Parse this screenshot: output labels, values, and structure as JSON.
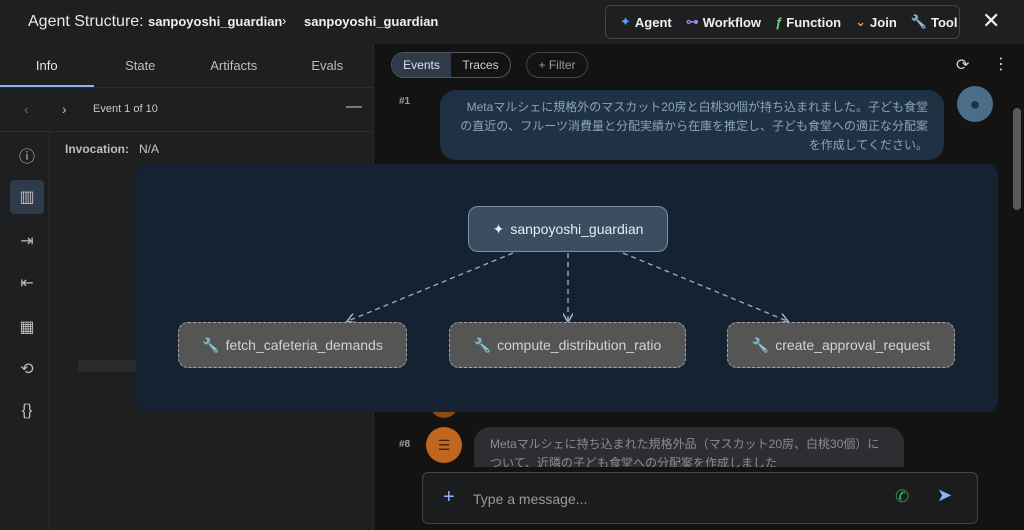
{
  "header": {
    "title": "Agent Structure:",
    "breadcrumb": [
      "sanpoyoshi_guardian",
      "sanpoyoshi_guardian"
    ],
    "legend": [
      {
        "icon": "sparkle-icon",
        "glyph": "✦",
        "color": "#4da3ff",
        "label": "Agent"
      },
      {
        "icon": "workflow-icon",
        "glyph": "⊶",
        "color": "#b07cf0",
        "label": "Workflow"
      },
      {
        "icon": "function-icon",
        "glyph": "ƒ",
        "color": "#6fd47a",
        "label": "Function"
      },
      {
        "icon": "join-icon",
        "glyph": "⌄",
        "color": "#f2a23c",
        "label": "Join"
      },
      {
        "icon": "wrench-icon",
        "glyph": "🔧",
        "color": "#e0e0e0",
        "label": "Tool"
      }
    ]
  },
  "left": {
    "tabs": [
      "Info",
      "State",
      "Artifacts",
      "Evals"
    ],
    "active_tab": "Info",
    "event_nav": "Event 1 of 10",
    "invocation_label": "Invocation:",
    "invocation_value": "N/A"
  },
  "right": {
    "view_tabs": [
      "Events",
      "Traces"
    ],
    "active_view": "Events",
    "filter_label": "Filter",
    "events": [
      {
        "num": "#1",
        "role": "user",
        "text": "Metaマルシェに規格外のマスカット20房と白桃30個が持ち込まれました。子ども食堂の直近の、フルーツ消費量と分配実績から在庫を推定し、子ども食堂への適正な分配案を作成してください。"
      },
      {
        "num": "#8",
        "role": "agent",
        "text": "Metaマルシェに持ち込まれた規格外品（マスカット20房、白桃30個）について、近隣の子ども食堂への分配案を作成しました"
      }
    ],
    "input_placeholder": "Type a message..."
  },
  "graph": {
    "root": {
      "icon": "sparkle-icon",
      "label": "sanpoyoshi_guardian"
    },
    "children": [
      {
        "icon": "wrench-icon",
        "label": "fetch_cafeteria_demands"
      },
      {
        "icon": "wrench-icon",
        "label": "compute_distribution_ratio"
      },
      {
        "icon": "wrench-icon",
        "label": "create_approval_request"
      }
    ]
  }
}
